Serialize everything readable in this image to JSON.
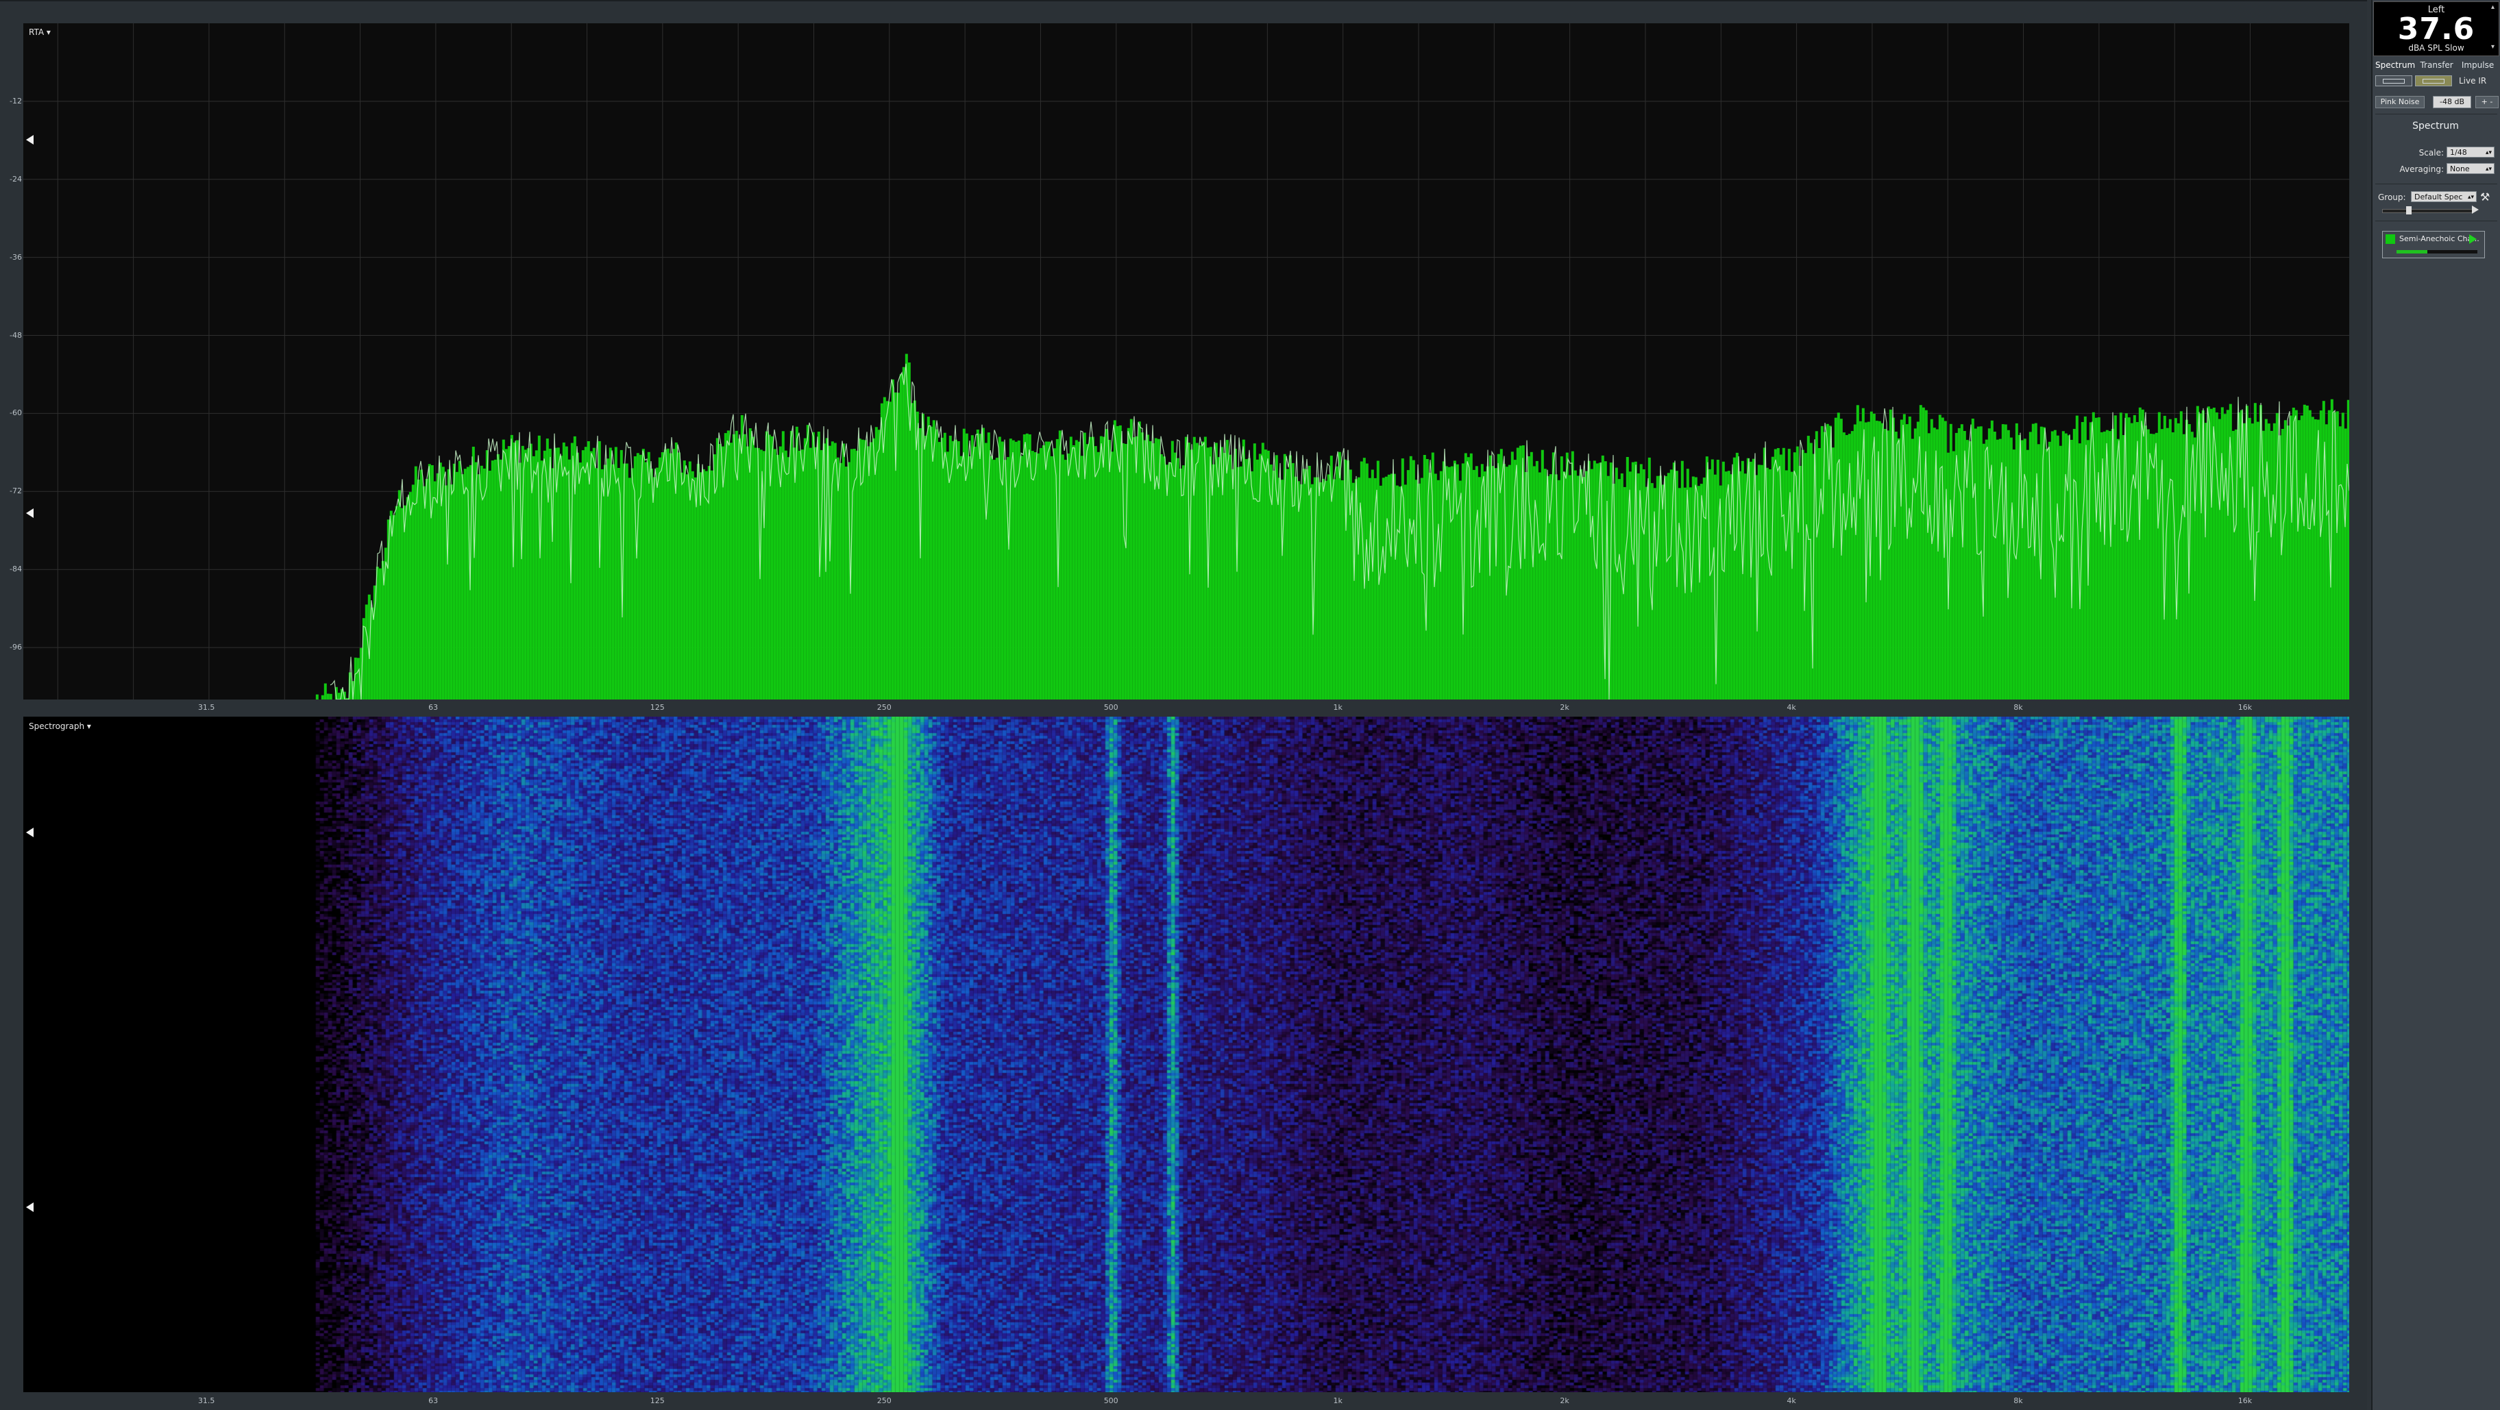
{
  "rta": {
    "title": "RTA ▾",
    "y_ticks": [
      "-12",
      "-24",
      "-36",
      "-48",
      "-60",
      "-72",
      "-84",
      "-96"
    ],
    "x_ticks": [
      "31.5",
      "63",
      "125",
      "250",
      "500",
      "1k",
      "2k",
      "4k",
      "8k",
      "16k"
    ]
  },
  "spectrograph": {
    "title": "Spectrograph ▾",
    "x_ticks": [
      "31.5",
      "63",
      "125",
      "250",
      "500",
      "1k",
      "2k",
      "4k",
      "8k",
      "16k"
    ]
  },
  "meter": {
    "channel": "Left",
    "value": "37.6",
    "unit": "dBA SPL Slow"
  },
  "tabs": [
    "Spectrum",
    "Transfer",
    "Impulse"
  ],
  "live_ir_label": "Live IR",
  "generator": {
    "signal": "Pink Noise",
    "level": "-48 dB",
    "adjust": "+ -"
  },
  "spectrum_section": {
    "title": "Spectrum",
    "scale_label": "Scale:",
    "scale_value": "1/48",
    "averaging_label": "Averaging:",
    "averaging_value": "None",
    "group_label": "Group:",
    "group_value": "Default Spec"
  },
  "trace": {
    "name": "Semi-Anechoic Cha..."
  },
  "colors": {
    "rta_fill": "#11c811",
    "rta_trace": "#c8f5c8",
    "plot_bg": "#0c0c0c",
    "grid": "#2f2f2f"
  },
  "chart_data": [
    {
      "type": "bar",
      "title": "RTA",
      "xscale": "log",
      "xlim": [
        18,
        22000
      ],
      "ylim": [
        -104,
        0
      ],
      "x_ticks": [
        31.5,
        63,
        125,
        250,
        500,
        1000,
        2000,
        4000,
        8000,
        16000
      ],
      "y_ticks": [
        -12,
        -24,
        -36,
        -48,
        -60,
        -72,
        -84,
        -96
      ],
      "grid": true,
      "series": [
        {
          "x": [
            48,
            52,
            56,
            60,
            66,
            72,
            80,
            90,
            100,
            110,
            120,
            130,
            140,
            150,
            160,
            180,
            200,
            220,
            240,
            255,
            265,
            280,
            300,
            330,
            360,
            400,
            440,
            480,
            530,
            600,
            700,
            800,
            900,
            1000,
            1200,
            1400,
            1600,
            1800,
            2000,
            2400,
            2800,
            3200,
            3600,
            4000,
            4500,
            5000,
            5500,
            6000,
            6500,
            7000,
            8000,
            9000,
            10000,
            11000,
            12000,
            13000,
            14000,
            15000,
            16000,
            17000,
            18000,
            19000,
            20000
          ],
          "values": [
            -104,
            -88,
            -74,
            -70,
            -69,
            -67,
            -65,
            -66,
            -66,
            -67,
            -68,
            -66,
            -69,
            -66,
            -62,
            -65,
            -64,
            -66,
            -64,
            -57,
            -52,
            -62,
            -65,
            -64,
            -66,
            -64,
            -65,
            -64,
            -63,
            -66,
            -66,
            -67,
            -69,
            -68,
            -69,
            -68,
            -68,
            -67,
            -68,
            -69,
            -69,
            -69,
            -67,
            -67,
            -63,
            -60,
            -62,
            -61,
            -64,
            -63,
            -64,
            -63,
            -62,
            -62,
            -61,
            -62,
            -61,
            -61,
            -59,
            -61,
            -61,
            -59,
            -60
          ]
        }
      ]
    },
    {
      "type": "heatmap",
      "title": "Spectrograph",
      "xscale": "log",
      "xlim": [
        18,
        22000
      ],
      "x_ticks": [
        31.5,
        63,
        125,
        250,
        500,
        1000,
        2000,
        4000,
        8000,
        16000
      ],
      "peak_frequencies": [
        260,
        500,
        600,
        5200,
        5800,
        6400,
        13000,
        16000,
        18000
      ],
      "band_levels": {
        "freq": [
          45,
          60,
          80,
          120,
          200,
          260,
          300,
          500,
          800,
          1000,
          1500,
          2000,
          3000,
          4300,
          5000,
          6000,
          8000,
          12000,
          16000,
          20000
        ],
        "level": [
          0.05,
          0.35,
          0.55,
          0.45,
          0.5,
          0.95,
          0.45,
          0.4,
          0.3,
          0.2,
          0.25,
          0.15,
          0.2,
          0.45,
          0.85,
          0.8,
          0.6,
          0.65,
          0.75,
          0.7
        ]
      }
    }
  ]
}
